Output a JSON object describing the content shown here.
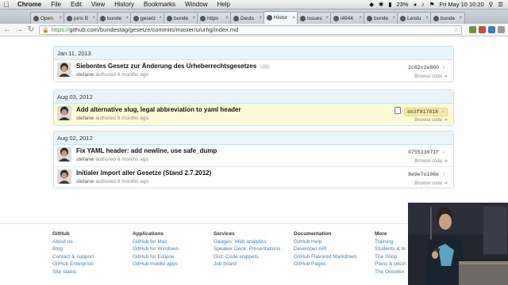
{
  "menubar": {
    "app": "Chrome",
    "items": [
      "File",
      "Edit",
      "View",
      "History",
      "Bookmarks",
      "Window",
      "Help"
    ],
    "battery": "23%",
    "clock": "Fri May 10  10:20"
  },
  "tabs": [
    {
      "label": "Open"
    },
    {
      "label": "juris B"
    },
    {
      "label": "bunde"
    },
    {
      "label": "gesetz"
    },
    {
      "label": "bunde"
    },
    {
      "label": "https"
    },
    {
      "label": "Deuts"
    },
    {
      "label": "Histor",
      "active": true
    },
    {
      "label": "Issues"
    },
    {
      "label": "i4944"
    },
    {
      "label": "bunde"
    },
    {
      "label": "Leistu"
    },
    {
      "label": "bunde"
    }
  ],
  "address": {
    "scheme": "https://",
    "url": "github.com/bundestag/gesetze/commits/master/u/urhg/index.md"
  },
  "groups": [
    {
      "date": "Jan 11, 2013",
      "commits": [
        {
          "message": "Siebentes Gesetz zur Änderung des Urheberrechtsgesetzes",
          "ellipsis": "…",
          "author": "stefanw",
          "time": "authored 4 months ago",
          "sha": "2c82c2e860",
          "browse": "Browse code",
          "highlight": false
        }
      ]
    },
    {
      "date": "Aug 03, 2012",
      "commits": [
        {
          "message": "Add alternative slug, legal abbreviation to yaml header",
          "author": "stefanw",
          "time": "authored 9 months ago",
          "sha": "bb3f017818",
          "browse": "Browse code",
          "highlight": true
        }
      ]
    },
    {
      "date": "Aug 02, 2012",
      "commits": [
        {
          "message": "Fix YAML header: add newline, use safe_dump",
          "author": "stefanw",
          "time": "authored 9 months ago",
          "sha": "075533071f",
          "browse": "Browse code",
          "highlight": false
        },
        {
          "message": "Initialer Import aller Gesetze (Stand 2.7.2012)",
          "author": "stefanw",
          "time": "authored 9 months ago",
          "sha": "8e9e7o106e",
          "browse": "Browse code",
          "highlight": false
        }
      ]
    }
  ],
  "footer": [
    {
      "heading": "GitHub",
      "links": [
        "About us",
        "Blog",
        "Contact & support",
        "GitHub Enterprise",
        "Site status"
      ]
    },
    {
      "heading": "Applications",
      "links": [
        "GitHub for Mac",
        "GitHub for Windows",
        "GitHub for Eclipse",
        "GitHub mobile apps"
      ]
    },
    {
      "heading": "Services",
      "links": [
        "Gauges: Web analytics",
        "Speaker Deck: Presentations",
        "Gist: Code snippets",
        "Job board"
      ]
    },
    {
      "heading": "Documentation",
      "links": [
        "GitHub Help",
        "Developer API",
        "GitHub Flavored Markdown",
        "GitHub Pages"
      ]
    },
    {
      "heading": "More",
      "links": [
        "Training",
        "Students & te",
        "The Shop",
        "Plans & pricin",
        "The Octodex"
      ]
    }
  ],
  "colors": {
    "link": "#4183c4",
    "group_header": "#e9f4fb",
    "highlight_row": "#fffbd5",
    "https_green": "#3a9a3a"
  }
}
